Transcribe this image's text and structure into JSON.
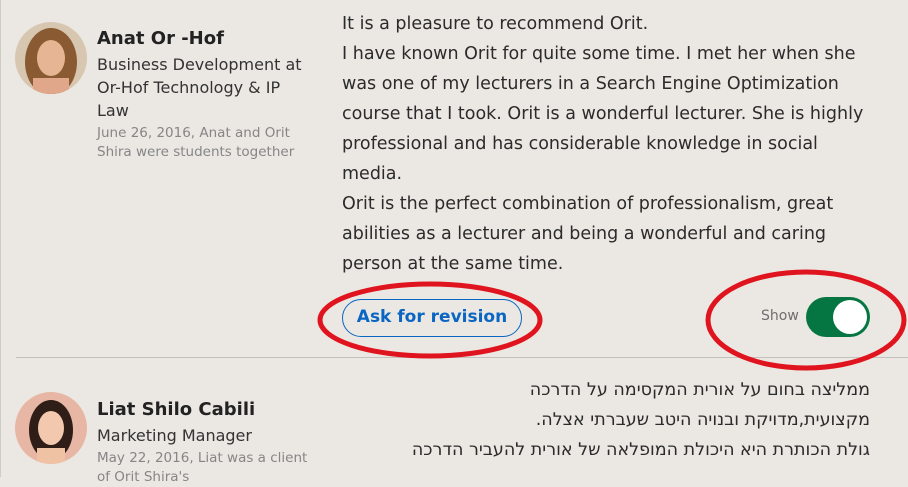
{
  "recommendations": [
    {
      "name": "Anat Or -Hof",
      "headline": "Business Development at Or-Hof Technology & IP Law",
      "meta": "June 26, 2016, Anat and Orit Shira were students together",
      "body": [
        "It is a pleasure to recommend Orit.",
        "I have known Orit for quite some time. I met her when she was one of my lecturers in a Search Engine Optimization course that I took. Orit is a wonderful lecturer. She is highly professional and has considerable knowledge in social media.",
        "Orit is the perfect combination of professionalism, great abilities as a lecturer and being a wonderful and caring person at the same time."
      ],
      "revise_label": "Ask for revision",
      "show_label": "Show",
      "show_enabled": true
    },
    {
      "name": "Liat Shilo Cabili",
      "headline": "Marketing Manager",
      "meta": "May 22, 2016, Liat was a client of Orit Shira's",
      "body": [
        "ממליצה בחום על אורית המקסימה על הדרכה",
        "מקצועית,מדויקת ובנויה היטב שעברתי אצלה.",
        "גולת הכותרת היא היכולת המופלאה של אורית להעביר הדרכה"
      ]
    }
  ],
  "colors": {
    "accent": "#0a66c2",
    "toggle_on": "#057642",
    "annotation": "#e0141e",
    "background": "#ebe8e3"
  }
}
